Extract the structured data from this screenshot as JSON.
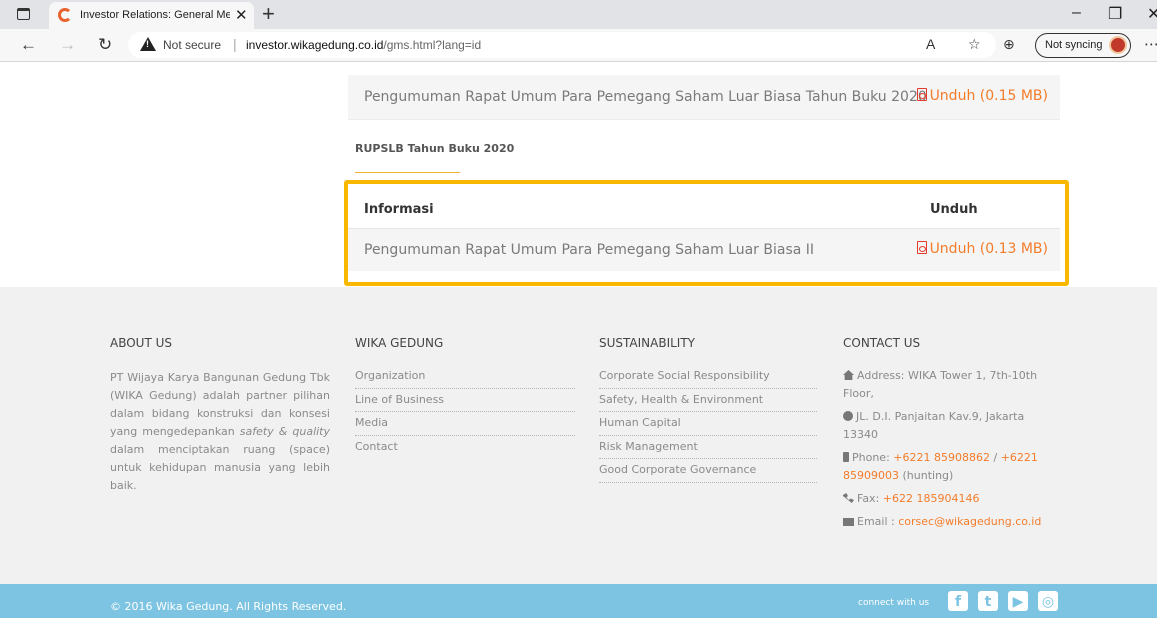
{
  "browser": {
    "tab_title": "Investor Relations: General Meeti",
    "tab_close": "✕",
    "new_tab": "+",
    "not_secure": "Not secure",
    "url_domain": "investor.wikagedung.co.id",
    "url_path": "/gms.html?lang=id",
    "sync_label": "Not syncing",
    "icons": [
      "tab-actions-icon",
      "favicon",
      "back-icon",
      "forward-icon",
      "refresh-icon",
      "warning-icon",
      "read-aloud-icon",
      "favorites-icon",
      "collections-icon",
      "profile-avatar",
      "more-icon",
      "minimize-icon",
      "maximize-icon",
      "close-icon"
    ]
  },
  "page": {
    "prev_row": {
      "text": "Pengumuman Rapat Umum Para Pemegang Saham Luar Biasa Tahun Buku 2020",
      "download": "Unduh (0.15 MB)"
    },
    "section_title": "RUPSLB Tahun Buku 2020",
    "table": {
      "header_info": "Informasi",
      "header_download": "Unduh",
      "rows": [
        {
          "text": "Pengumuman Rapat Umum Para Pemegang Saham Luar Biasa II",
          "download": "Unduh (0.13 MB)"
        }
      ]
    },
    "highlight_color": "#f9b800",
    "accent_color": "#f47c2b"
  },
  "footer": {
    "about": {
      "heading": "ABOUT US",
      "text_1": "PT Wijaya Karya Bangunan Gedung Tbk (WIKA Gedung) adalah partner pilihan dalam bidang konstruksi dan konsesi yang mengedepankan ",
      "text_em1": "safety &",
      "text_em2": "quality",
      "text_2": " dalam menciptakan ruang (space) untuk kehidupan manusia yang lebih baik."
    },
    "wika": {
      "heading": "WIKA GEDUNG",
      "items": [
        "Organization",
        "Line of Business",
        "Media",
        "Contact"
      ]
    },
    "sustainability": {
      "heading": "SUSTAINABILITY",
      "items": [
        "Corporate Social Responsibility",
        "Safety, Health & Environment",
        "Human Capital",
        "Risk Management",
        "Good Corporate Governance"
      ]
    },
    "contact": {
      "heading": "CONTACT US",
      "address": "Address: WIKA Tower 1, 7th-10th Floor,",
      "street": "JL. D.I. Panjaitan Kav.9, Jakarta 13340",
      "phone_label": "Phone: ",
      "phone_1": "+6221 85908862",
      "phone_sep": " / ",
      "phone_2": "+6221 85909003",
      "phone_note": " (hunting)",
      "fax_label": "Fax: ",
      "fax": "+622 185904146",
      "email_label": "Email : ",
      "email": "corsec@wikagedung.co.id"
    },
    "copyright": "© 2016 Wika Gedung. All Rights Reserved.",
    "connect": "connect with us",
    "social": [
      {
        "name": "facebook",
        "glyph": "f"
      },
      {
        "name": "twitter",
        "glyph": "t"
      },
      {
        "name": "youtube",
        "glyph": "▶"
      },
      {
        "name": "instagram",
        "glyph": "◎"
      }
    ]
  }
}
